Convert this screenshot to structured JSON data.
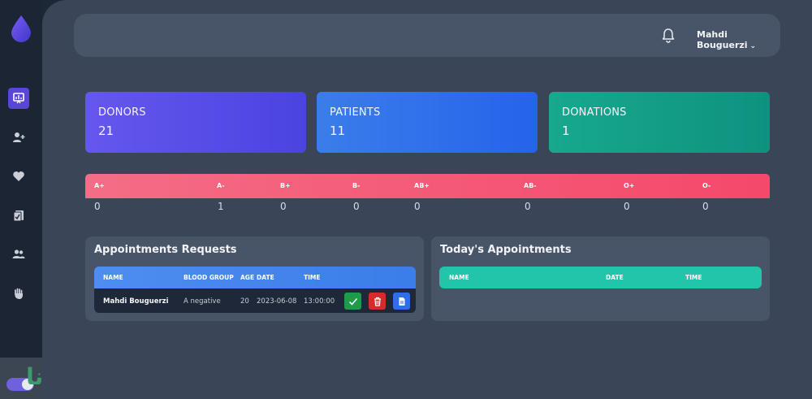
{
  "colors": {
    "sidebar_bg": "#1b2534",
    "main_bg": "#3a4658",
    "accent": "#5a45d9",
    "donors_card": "#5a4ce8",
    "patients_card": "#2f71ea",
    "donations_card": "#12a088",
    "blood_bar": "#f55c78",
    "appointments_header": "#458af0",
    "today_header": "#22c4aa"
  },
  "sidebar": {
    "items": [
      {
        "icon": "dashboard-icon",
        "active": true
      },
      {
        "icon": "add-user-icon",
        "active": false
      },
      {
        "icon": "heart-icon",
        "active": false
      },
      {
        "icon": "clipboard-icon",
        "active": false
      },
      {
        "icon": "users-icon",
        "active": false
      },
      {
        "icon": "hand-icon",
        "active": false
      }
    ],
    "theme_toggle_on": true
  },
  "header": {
    "user_name": "Mahdi Bouguerzi"
  },
  "stats": [
    {
      "label": "DONORS",
      "value": "21"
    },
    {
      "label": "PATIENTS",
      "value": "11"
    },
    {
      "label": "DONATIONS",
      "value": "1"
    }
  ],
  "blood_groups": {
    "headers": [
      "A+",
      "A-",
      "B+",
      "B-",
      "AB+",
      "AB-",
      "O+",
      "O-"
    ],
    "values": [
      "0",
      "1",
      "0",
      "0",
      "0",
      "0",
      "0",
      "0"
    ]
  },
  "appointment_requests": {
    "title": "Appointments Requests",
    "columns": [
      "NAME",
      "BLOOD GROUP",
      "AGE",
      "DATE",
      "TIME"
    ],
    "rows": [
      {
        "name": "Mahdi Bouguerzi",
        "blood_group": "A negative",
        "age": "20",
        "date": "2023-06-08",
        "time": "13:00:00"
      }
    ]
  },
  "todays_appointments": {
    "title": "Today's Appointments",
    "columns": [
      "NAME",
      "DATE",
      "TIME"
    ]
  }
}
